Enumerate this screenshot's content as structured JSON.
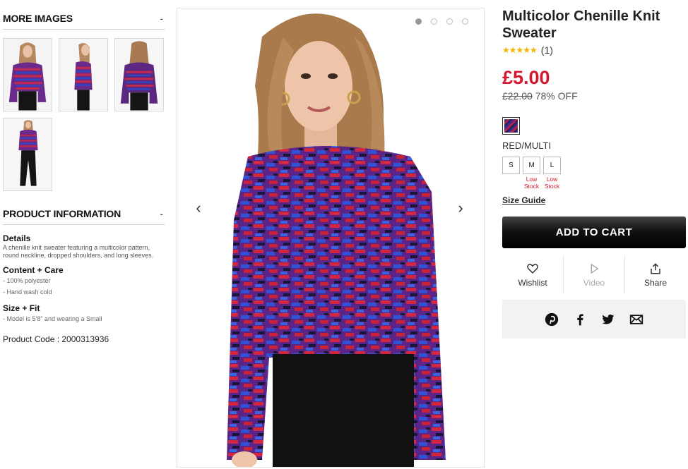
{
  "left": {
    "more_images": {
      "title": "MORE IMAGES",
      "toggle": "-"
    },
    "product_info": {
      "title": "PRODUCT INFORMATION",
      "toggle": "-",
      "details_label": "Details",
      "details_text": "A chenille knit sweater featuring a multicolor pattern, round neckline, dropped shoulders, and long sleeves.",
      "content_label": "Content + Care",
      "content_items": [
        "- 100% polyester",
        "- Hand wash cold"
      ],
      "size_label": "Size + Fit",
      "size_items": [
        "- Model is 5'8\" and wearing a Small"
      ],
      "product_code": "Product Code : 2000313936"
    }
  },
  "gallery": {
    "arrow_prev": "‹",
    "arrow_next": "›",
    "dot_count": 4,
    "active_dot": 0
  },
  "product": {
    "title": "Multicolor Chenille Knit Sweater",
    "stars": "★★★★★",
    "rating_count": "(1)",
    "price": "£5.00",
    "was_price": "£22.00",
    "discount": "78% OFF",
    "color_name": "RED/MULTI",
    "sizes": [
      {
        "label": "S",
        "stock": ""
      },
      {
        "label": "M",
        "stock": "Low Stock"
      },
      {
        "label": "L",
        "stock": "Low Stock"
      }
    ],
    "size_guide": "Size Guide",
    "add_to_cart": "ADD TO CART",
    "actions": {
      "wishlist": "Wishlist",
      "video": "Video",
      "share": "Share"
    }
  },
  "colors": {
    "price_red": "#d4172e",
    "star_gold": "#f4b400",
    "social_bg": "#f2f2f2"
  },
  "icons": [
    "heart-icon",
    "play-icon",
    "share-icon",
    "pinterest-icon",
    "facebook-icon",
    "twitter-icon",
    "email-icon"
  ]
}
